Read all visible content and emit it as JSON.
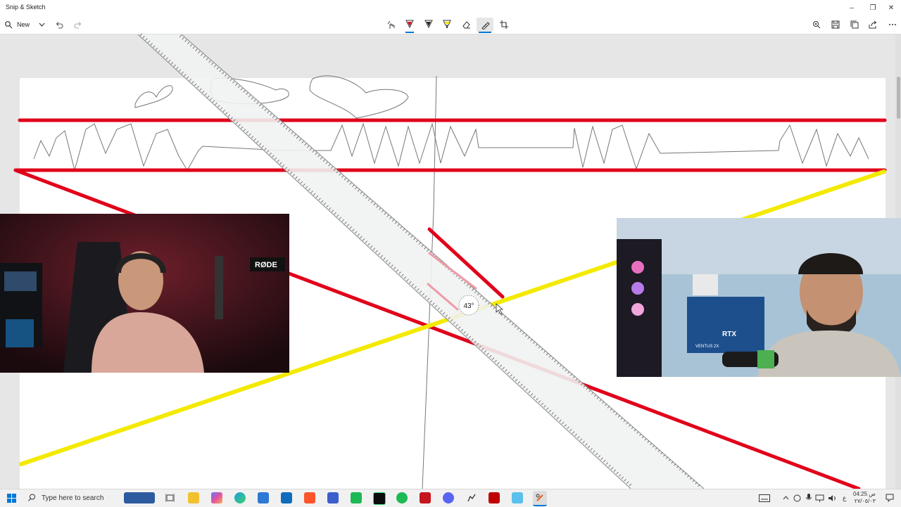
{
  "window": {
    "title": "Snip & Sketch"
  },
  "window_controls": {
    "minimize": "–",
    "maximize": "❐",
    "close": "✕"
  },
  "toolbar": {
    "new_label": "New",
    "colors": {
      "ballpoint": "#d9001b",
      "pencil": "#222222",
      "highlighter": "#f5e600",
      "accent": "#0078d4"
    }
  },
  "drawing": {
    "ruler_angle_label": "43°",
    "colors": {
      "red": "#e1001a",
      "yellow": "#f3ea00",
      "pencil": "#6b6b6b",
      "ruler": "#f1f2f2"
    }
  },
  "webcams": {
    "left": {
      "brand_label": "RØDE"
    },
    "right": {
      "brand_label": "RTX",
      "sub_label": "VENTUS 2X"
    }
  },
  "taskbar": {
    "search_placeholder": "Type here to search",
    "tray": {
      "language": "ع",
      "time": "04:25 ص",
      "date": "٢٧/٠٥/٠٣"
    }
  }
}
